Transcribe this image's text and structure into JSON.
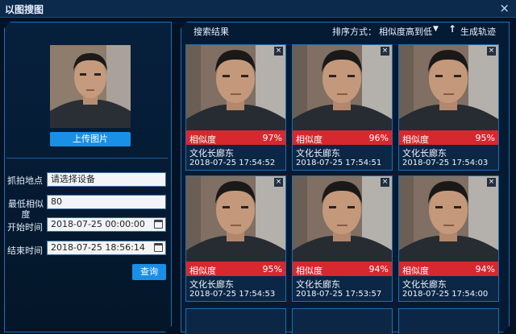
{
  "window": {
    "title": "以图搜图",
    "close_glyph": "×"
  },
  "left": {
    "upload_label": "上传图片",
    "fields": {
      "location_label": "抓拍地点",
      "location_value": "请选择设备",
      "similarity_label": "最低相似度",
      "similarity_value": "80",
      "start_label": "开始时间",
      "start_value": "2018-07-25 00:00:00",
      "end_label": "结束时间",
      "end_value": "2018-07-25 18:56:14"
    },
    "query_label": "查询"
  },
  "results": {
    "title": "搜索结果",
    "sort_label": "排序方式：",
    "sort_value": "相似度高到低",
    "trajectory_icon": "up-arrow-icon",
    "trajectory_label": "生成轨迹",
    "close_glyph": "×",
    "items": [
      {
        "sim_label": "相似度",
        "sim": "97%",
        "location": "文化长廊东",
        "time": "2018-07-25 17:54:52"
      },
      {
        "sim_label": "相似度",
        "sim": "96%",
        "location": "文化长廊东",
        "time": "2018-07-25 17:54:51"
      },
      {
        "sim_label": "相似度",
        "sim": "95%",
        "location": "文化长廊东",
        "time": "2018-07-25 17:54:03"
      },
      {
        "sim_label": "相似度",
        "sim": "95%",
        "location": "文化长廊东",
        "time": "2018-07-25 17:54:53"
      },
      {
        "sim_label": "相似度",
        "sim": "94%",
        "location": "文化长廊东",
        "time": "2018-07-25 17:53:57"
      },
      {
        "sim_label": "相似度",
        "sim": "94%",
        "location": "文化长廊东",
        "time": "2018-07-25 17:54:00"
      }
    ]
  },
  "colors": {
    "accent": "#1a8fe6",
    "similarity_bar": "#d7282f",
    "background": "#041225",
    "panel_border": "#1e6fb0"
  }
}
